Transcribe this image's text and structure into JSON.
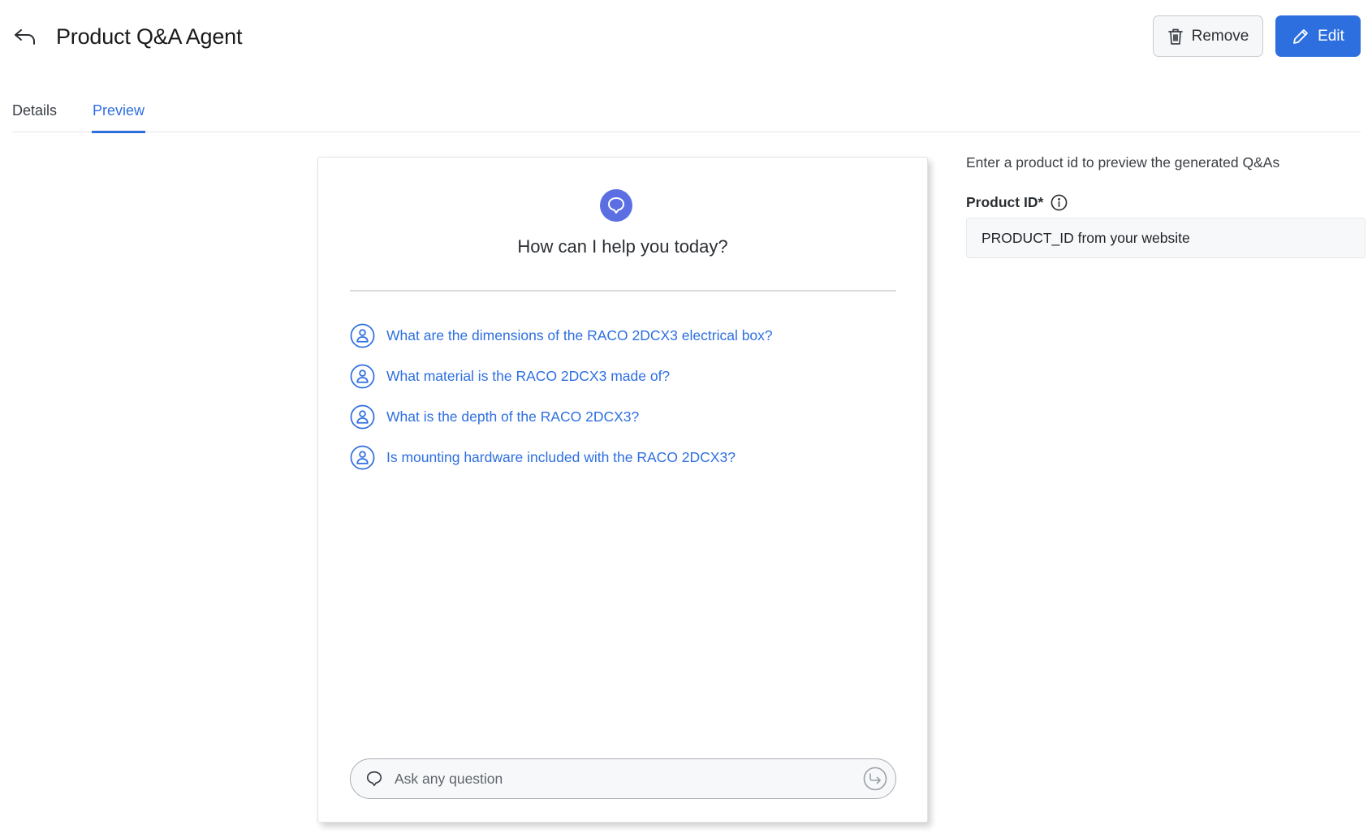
{
  "header": {
    "title": "Product Q&A Agent",
    "back_icon": "undo-arrow-icon",
    "remove_label": "Remove",
    "remove_icon": "trash-icon",
    "edit_label": "Edit",
    "edit_icon": "pencil-icon"
  },
  "tabs": [
    {
      "label": "Details",
      "active": false
    },
    {
      "label": "Preview",
      "active": true
    }
  ],
  "chat": {
    "avatar_icon": "chat-bubble-icon",
    "greeting": "How can I help you today?",
    "suggestions": [
      "What are the dimensions of the RACO 2DCX3 electrical box?",
      "What material is the RACO 2DCX3 made of?",
      "What is the depth of the RACO 2DCX3?",
      "Is mounting hardware included with the RACO 2DCX3?"
    ],
    "suggestion_icon": "user-circle-icon",
    "input_placeholder": "Ask any question",
    "input_icon": "chat-bubble-icon",
    "send_icon": "send-arrow-icon"
  },
  "side_panel": {
    "hint": "Enter a product id to preview the generated Q&As",
    "product_id_label": "Product ID*",
    "info_icon": "info-icon",
    "product_id_placeholder": "PRODUCT_ID from your website"
  },
  "colors": {
    "accent": "#2e6fe0",
    "avatar": "#5b6fe3"
  }
}
